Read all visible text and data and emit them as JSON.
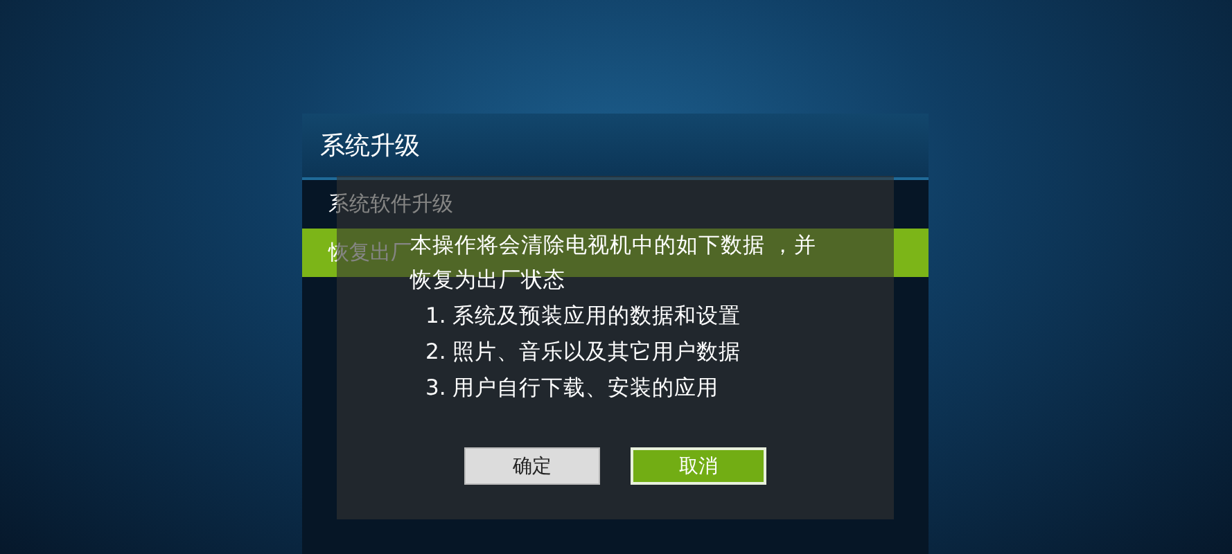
{
  "panel": {
    "title": "系统升级",
    "items": [
      {
        "label": "系统软件升级",
        "selected": false
      },
      {
        "label": "恢复出厂",
        "selected": true
      }
    ]
  },
  "dialog": {
    "message": "本操作将会清除电视机中的如下数据 ，并恢复为出厂状态",
    "list": [
      "1. 系统及预装应用的数据和设置",
      "2. 照片、音乐以及其它用户数据",
      "3. 用户自行下载、安装的应用"
    ],
    "buttons": [
      {
        "label": "确定",
        "selected": false
      },
      {
        "label": "取消",
        "selected": true
      }
    ]
  }
}
